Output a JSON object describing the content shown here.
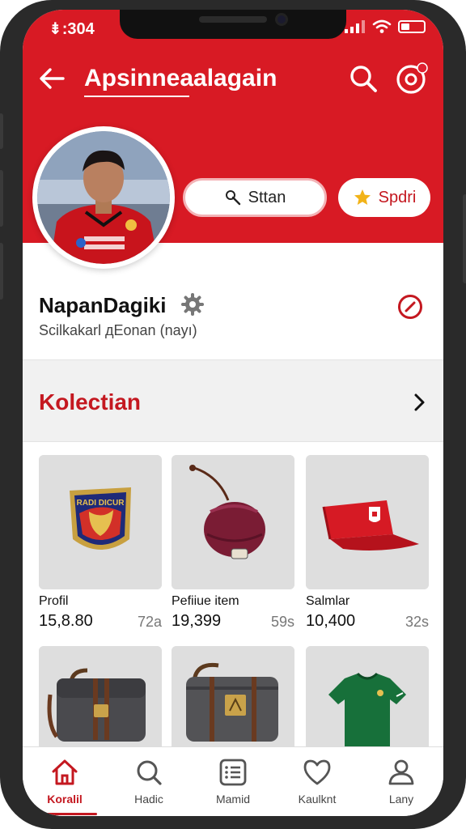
{
  "status_bar": {
    "time": "⇟:304"
  },
  "app_bar": {
    "title": "Apsinneaalagain"
  },
  "actions": {
    "stan_label": "Sttan",
    "sport_label": "Spdri"
  },
  "profile": {
    "name": "NapanDagiki",
    "subtitle": "Scilkakarl дEonan (nayı)"
  },
  "section": {
    "title": "Kolectian"
  },
  "items": [
    {
      "name": "Profil",
      "price": "15,8.80",
      "count": "72a"
    },
    {
      "name": "Pefiiue item",
      "price": "19,399",
      "count": "59s"
    },
    {
      "name": "Salmlar",
      "price": "10,400",
      "count": "32s"
    }
  ],
  "nav": [
    {
      "label": "Koralil",
      "icon": "home-icon",
      "active": true
    },
    {
      "label": "Hadic",
      "icon": "search-icon"
    },
    {
      "label": "Mamid",
      "icon": "list-icon"
    },
    {
      "label": "Kaulknt",
      "icon": "heart-icon"
    },
    {
      "label": "Lany",
      "icon": "user-icon"
    }
  ],
  "colors": {
    "brand_red": "#d81a24",
    "accent_text": "#c41820",
    "background": "#ffffff"
  }
}
